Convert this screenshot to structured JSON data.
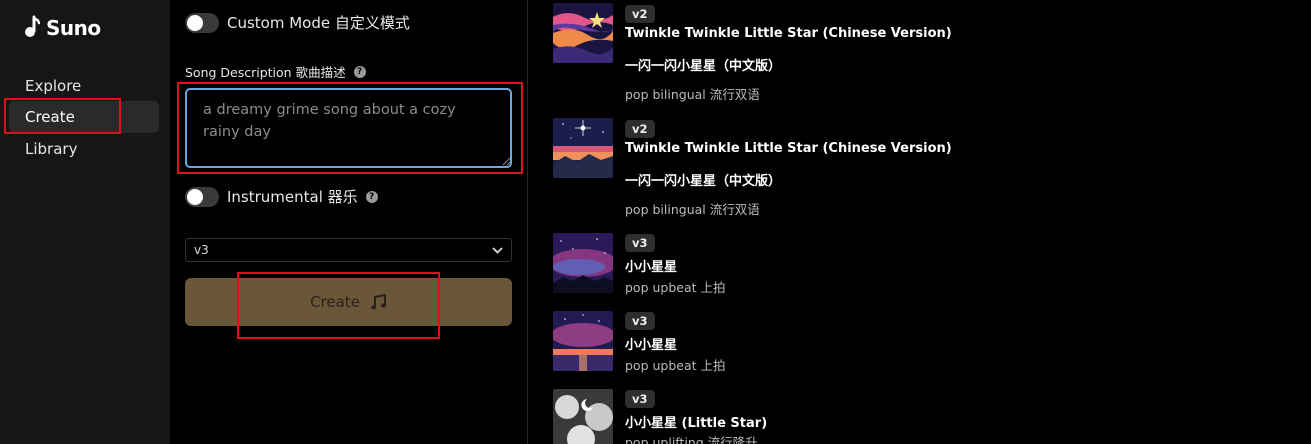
{
  "app": {
    "name": "Suno"
  },
  "sidebar": {
    "items": [
      {
        "label": "Explore"
      },
      {
        "label": "Create"
      },
      {
        "label": "Library"
      }
    ]
  },
  "form": {
    "custom_mode_label": "Custom Mode 自定义模式",
    "song_description_label": "Song Description 歌曲描述",
    "song_description_value": "a dreamy grime song about a cozy rainy day",
    "instrumental_label": "Instrumental 器乐",
    "model_select_value": "v3",
    "create_button_label": "Create"
  },
  "songs": [
    {
      "version": "v2",
      "title": "Twinkle Twinkle Little Star (Chinese Version)",
      "subtitle": "一闪一闪小星星（中文版）",
      "tags": "pop bilingual 流行双语"
    },
    {
      "version": "v2",
      "title": "Twinkle Twinkle Little Star (Chinese Version)",
      "subtitle": "一闪一闪小星星（中文版）",
      "tags": "pop bilingual 流行双语"
    },
    {
      "version": "v3",
      "title": "小小星星",
      "tags": "pop upbeat 上拍"
    },
    {
      "version": "v3",
      "title": "小小星星",
      "tags": "pop upbeat 上拍"
    },
    {
      "version": "v3",
      "title": "小小星星 (Little Star)",
      "tags": "pop uplifting 流行隆升"
    }
  ],
  "colors": {
    "accent_button": "#6a5638",
    "focus_border": "#6aa8e0",
    "annotation_red": "#e0101a"
  }
}
